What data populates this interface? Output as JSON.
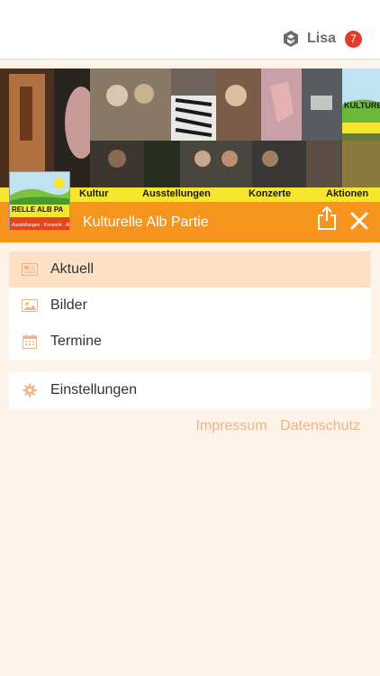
{
  "user": {
    "name": "Lisa",
    "notification_count": "7"
  },
  "banner": {
    "strip_labels": [
      "Kultur",
      "Ausstellungen",
      "Konzerte",
      "Aktionen"
    ],
    "logo_text": "RELLE ALB PA",
    "corner_text": "KULTURE"
  },
  "header": {
    "title": "Kulturelle Alb Partie"
  },
  "menu": {
    "primary": [
      {
        "label": "Aktuell",
        "icon": "newspaper-icon",
        "active": true
      },
      {
        "label": "Bilder",
        "icon": "image-icon",
        "active": false
      },
      {
        "label": "Termine",
        "icon": "calendar-icon",
        "active": false
      }
    ],
    "secondary": [
      {
        "label": "Einstellungen",
        "icon": "gear-icon",
        "active": false
      }
    ]
  },
  "footer": {
    "impressum": "Impressum",
    "datenschutz": "Datenschutz"
  },
  "colors": {
    "accent": "#f7941d",
    "active_row": "#fde1c7",
    "background": "#fef3e8",
    "badge": "#e23b2a",
    "link": "#f4b183"
  }
}
